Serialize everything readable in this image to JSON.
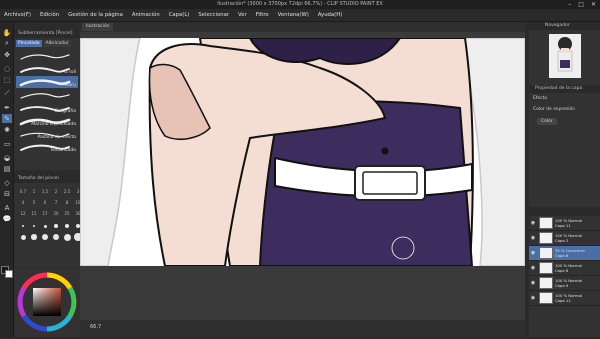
{
  "window": {
    "title": "Ilustración* (3000 x 3700px 72dpi 66.7%) - CLIP STUDIO PAINT EX",
    "controls": [
      "–",
      "□",
      "✕"
    ]
  },
  "menu": [
    "Archivo(F)",
    "Edición",
    "Gestión de la página",
    "Animación",
    "Capa(L)",
    "Seleccionar",
    "Ver",
    "Filtro",
    "Ventana(W)",
    "Ayuda(H)"
  ],
  "canvas_tab": "Ilustración",
  "sub_tool": {
    "header": "Subherramienta [Pincel]",
    "tabs": [
      "Pincelado",
      "Albricadur"
    ],
    "active_tab": "Pincelado",
    "brushes": [
      {
        "label": "",
        "active": false
      },
      {
        "label": "G roll",
        "active": false
      },
      {
        "label": "Maru",
        "active": true
      },
      {
        "label": "",
        "active": false
      },
      {
        "label": "Caligrafía",
        "active": false
      },
      {
        "label": "Marcillo o pincelada",
        "active": false
      },
      {
        "label": "Pastilla de efecto",
        "active": false
      },
      {
        "label": "Texturizado",
        "active": false
      }
    ]
  },
  "brush_size": {
    "header": "Tamaño del pincel",
    "values": [
      "0.7",
      "1",
      "1.5",
      "2",
      "2.5",
      "3",
      "4",
      "5",
      "6",
      "7",
      "8",
      "10",
      "12",
      "15",
      "17",
      "20",
      "25",
      "30"
    ]
  },
  "colors": {
    "skin": "#f4ddd2",
    "skin_shadow": "#e7c3b6",
    "hair": "#eeeeee",
    "hair_line": "#c9c9c9",
    "dress": "#3d2c5e",
    "dress_dark": "#2e2148",
    "belt": "#ffffff",
    "accent": "#4a6fa5"
  },
  "navigator": {
    "header": "Navegador"
  },
  "properties": {
    "header": "Propiedad de la capa",
    "effect_label": "Efecto",
    "color_label": "Color de expresión",
    "color_value": "Color"
  },
  "layers": [
    {
      "blend": "100 % Normal",
      "name": "Capa 11",
      "active": false
    },
    {
      "blend": "100 % Normal",
      "name": "Capa 2",
      "active": false
    },
    {
      "blend": "35 % Oscurecer",
      "name": "Capa 6",
      "active": true
    },
    {
      "blend": "100 % Normal",
      "name": "Capa 8",
      "active": false
    },
    {
      "blend": "100 % Normal",
      "name": "Capa 9",
      "active": false
    },
    {
      "blend": "100 % Normal",
      "name": "Capa 12",
      "active": false
    }
  ],
  "bottom": {
    "zoom": "66.7"
  },
  "icons": [
    "hand-icon",
    "zoom-icon",
    "move-icon",
    "lasso-icon",
    "selection-icon",
    "eyedropper-icon",
    "pen-icon",
    "brush-icon",
    "airbrush-icon",
    "eraser-icon",
    "fill-icon",
    "gradient-icon",
    "figure-icon",
    "text-icon",
    "balloon-icon",
    "ruler-icon",
    "eye-icon"
  ]
}
